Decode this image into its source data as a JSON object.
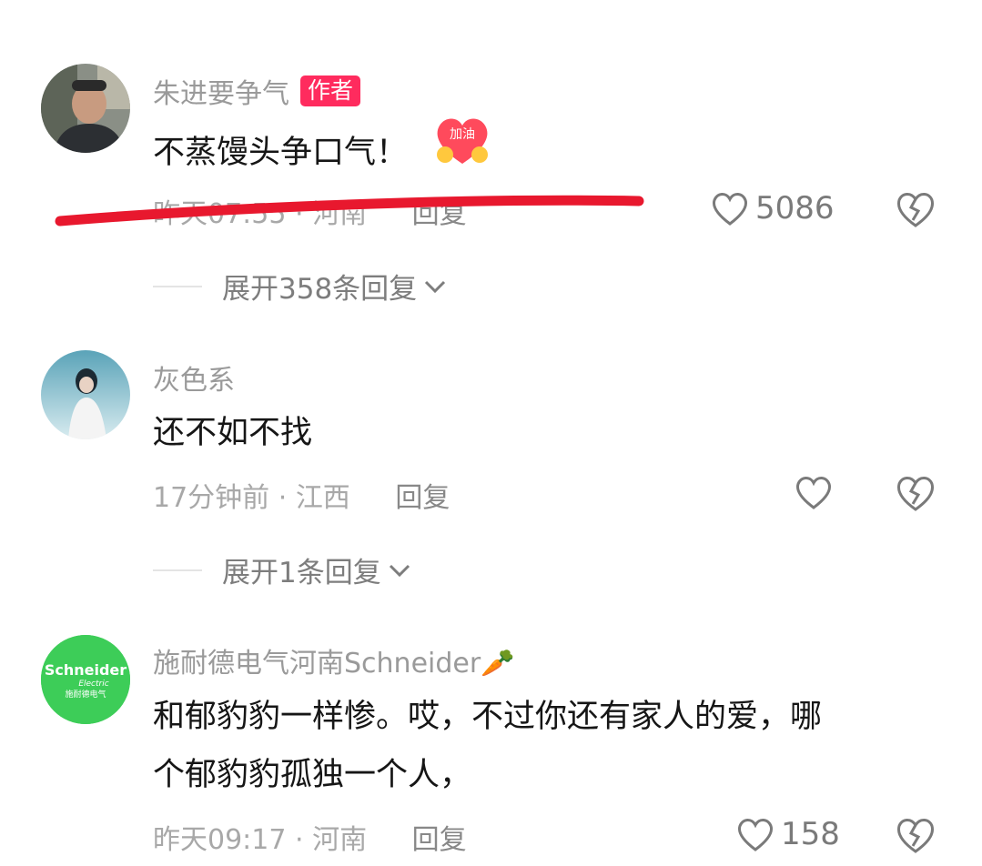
{
  "comments": [
    {
      "username": "朱进要争气",
      "badge": "作者",
      "content": "不蒸馒头争口气！",
      "sticker": "加油",
      "time": "昨天07:55",
      "location": "河南",
      "reply_label": "回复",
      "likes": "5086",
      "expand_label": "展开358条回复"
    },
    {
      "username": "灰色系",
      "content": "还不如不找",
      "time": "17分钟前",
      "location": "江西",
      "reply_label": "回复",
      "likes": "",
      "expand_label": "展开1条回复"
    },
    {
      "username": "施耐德电气河南Schneider🥕",
      "content_line1": "和郁豹豹一样惨。哎，不过你还有家人的爱，哪",
      "content_line2": "个郁豹豹孤独一个人，",
      "time": "昨天09:17",
      "location": "河南",
      "reply_label": "回复",
      "likes": "158",
      "avatar_logo_line1": "Schneider",
      "avatar_logo_line2": "Electric",
      "avatar_logo_line3": "施耐德电气"
    }
  ],
  "colors": {
    "username": "#9a9a9a",
    "content": "#161616",
    "badge": "#ff2b5e",
    "annotation_stroke": "#e8182e",
    "schneider_green": "#3dcd58"
  },
  "icons": [
    "heart-outline-icon",
    "broken-heart-icon",
    "chevron-down-icon"
  ]
}
